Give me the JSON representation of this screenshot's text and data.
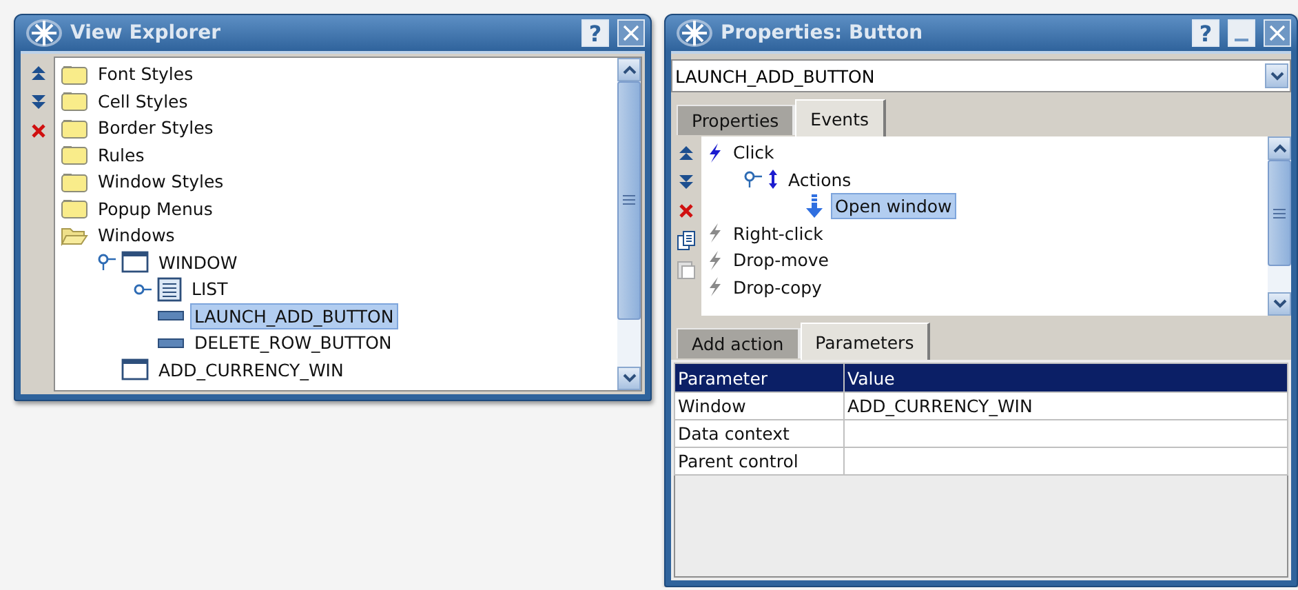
{
  "explorer": {
    "title": "View Explorer",
    "title_buttons": [
      {
        "kind": "help",
        "label": "?"
      },
      {
        "kind": "close"
      }
    ],
    "toolbar": [
      {
        "kind": "up"
      },
      {
        "kind": "down"
      },
      {
        "kind": "delete"
      }
    ],
    "tree": [
      {
        "label": "Font Styles",
        "kind": "folder",
        "selected": false
      },
      {
        "label": "Cell Styles",
        "kind": "folder",
        "selected": false
      },
      {
        "label": "Border Styles",
        "kind": "folder",
        "selected": false
      },
      {
        "label": "Rules",
        "kind": "folder",
        "selected": false
      },
      {
        "label": "Window Styles",
        "kind": "folder",
        "selected": false
      },
      {
        "label": "Popup Menus",
        "kind": "folder",
        "selected": false
      },
      {
        "label": "Windows",
        "kind": "folder",
        "selected": false,
        "expanded": true,
        "children": [
          {
            "label": "WINDOW",
            "kind": "window",
            "selected": false,
            "expanded": true,
            "children": [
              {
                "label": "LIST",
                "kind": "list",
                "selected": false,
                "expanded": false
              },
              {
                "label": "LAUNCH_ADD_BUTTON",
                "kind": "button",
                "selected": true
              },
              {
                "label": "DELETE_ROW_BUTTON",
                "kind": "button",
                "selected": false
              }
            ]
          },
          {
            "label": "ADD_CURRENCY_WIN",
            "kind": "window",
            "selected": false
          }
        ]
      }
    ]
  },
  "properties": {
    "title": "Properties: Button",
    "title_buttons": [
      {
        "kind": "help",
        "label": "?"
      },
      {
        "kind": "minimize"
      },
      {
        "kind": "close"
      }
    ],
    "object_select": {
      "value": "LAUNCH_ADD_BUTTON"
    },
    "tabs": [
      {
        "label": "Properties",
        "selected": false
      },
      {
        "label": "Events",
        "selected": true
      }
    ],
    "toolbar": [
      {
        "kind": "up",
        "disabled": false
      },
      {
        "kind": "down",
        "disabled": false
      },
      {
        "kind": "delete",
        "disabled": false
      },
      {
        "kind": "copy",
        "disabled": false
      },
      {
        "kind": "paste",
        "disabled": true
      }
    ],
    "events": [
      {
        "label": "Click",
        "kind": "event",
        "active": true,
        "selected": false,
        "children": [
          {
            "label": "Actions",
            "kind": "actions",
            "selected": false,
            "expanded": true,
            "children": [
              {
                "label": "Open window",
                "kind": "action",
                "selected": true
              }
            ]
          }
        ]
      },
      {
        "label": "Right-click",
        "kind": "event",
        "active": false,
        "selected": false
      },
      {
        "label": "Drop-move",
        "kind": "event",
        "active": false,
        "selected": false
      },
      {
        "label": "Drop-copy",
        "kind": "event",
        "active": false,
        "selected": false
      }
    ],
    "action_tabs": [
      {
        "label": "Add action",
        "selected": false
      },
      {
        "label": "Parameters",
        "selected": true
      }
    ],
    "table": {
      "columns": [
        "Parameter",
        "Value"
      ],
      "rows": [
        [
          "Window",
          "ADD_CURRENCY_WIN"
        ],
        [
          "Data context",
          ""
        ],
        [
          "Parent control",
          ""
        ]
      ]
    }
  }
}
